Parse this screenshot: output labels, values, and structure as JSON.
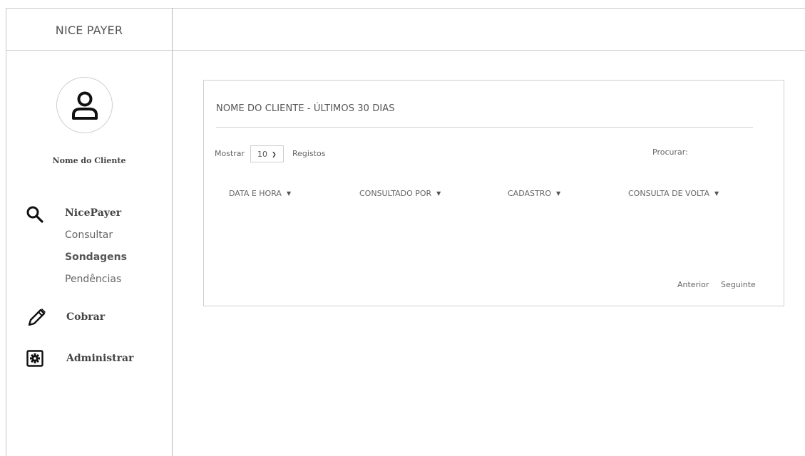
{
  "header": {
    "brand": "NICE PAYER"
  },
  "profile": {
    "avatar_icon": "user-icon",
    "name": "Nome do Cliente"
  },
  "nav": {
    "nicepayer": {
      "icon": "search-icon",
      "title": "NicePayer",
      "items": [
        {
          "label": "Consultar",
          "active": false
        },
        {
          "label": "Sondagens",
          "active": true
        },
        {
          "label": "Pendências",
          "active": false
        }
      ]
    },
    "cobrar": {
      "icon": "pencil-icon",
      "title": "Cobrar"
    },
    "administrar": {
      "icon": "gear-icon",
      "title": "Administrar"
    }
  },
  "card": {
    "title": "NOME DO CLIENTE - ÚLTIMOS 30 DIAS",
    "show_label": "Mostrar",
    "page_size": "10",
    "records_label": "Registos",
    "search_label": "Procurar:",
    "columns": [
      "DATA E HORA",
      "CONSULTADO POR",
      "CADASTRO",
      "CONSULTA DE VOLTA"
    ],
    "rows": [],
    "prev_label": "Anterior",
    "next_label": "Seguinte"
  }
}
